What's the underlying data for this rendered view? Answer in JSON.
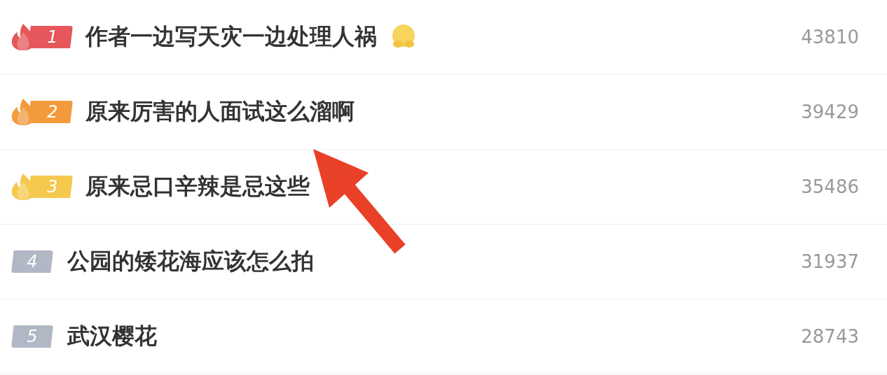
{
  "hot_list": [
    {
      "rank": "1",
      "kind": "hot",
      "color": "#e5575a",
      "title": "作者一边写天灾一边处理人祸",
      "emoji": true,
      "count": "43810"
    },
    {
      "rank": "2",
      "kind": "hot",
      "color": "#f39a3c",
      "title": "原来厉害的人面试这么溜啊",
      "emoji": false,
      "count": "39429"
    },
    {
      "rank": "3",
      "kind": "hot",
      "color": "#f5c84e",
      "title": "原来忌口辛辣是忌这些",
      "emoji": false,
      "count": "35486"
    },
    {
      "rank": "4",
      "kind": "plain",
      "color": "#b1b7c4",
      "title": "公园的矮花海应该怎么拍",
      "emoji": false,
      "count": "31937"
    },
    {
      "rank": "5",
      "kind": "plain",
      "color": "#b1b7c4",
      "title": "武汉樱花",
      "emoji": false,
      "count": "28743"
    }
  ]
}
